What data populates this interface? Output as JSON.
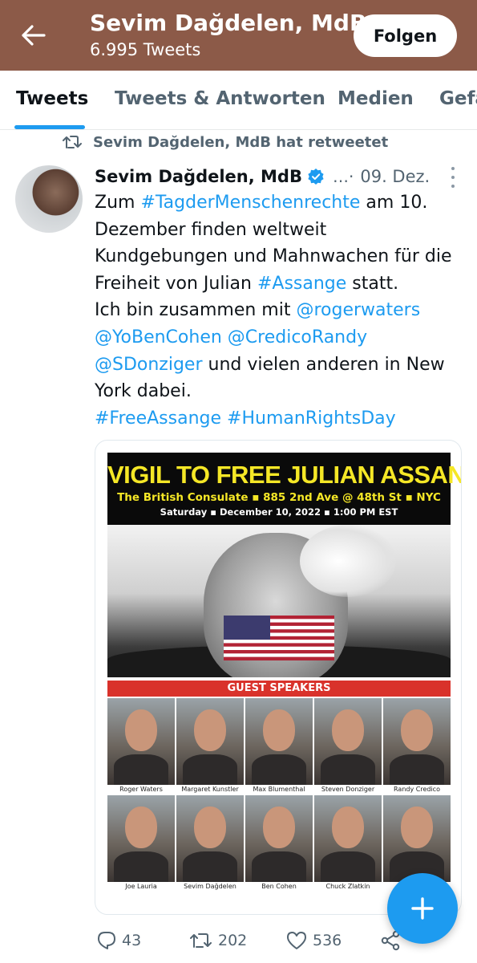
{
  "header": {
    "title": "Sevim Dağdelen, MdB",
    "subtitle": "6.995 Tweets",
    "follow_label": "Folgen",
    "back_icon": "arrow-left-icon",
    "bg_color": "#8c5a48"
  },
  "tabs": [
    {
      "label": "Tweets",
      "active": true
    },
    {
      "label": "Tweets & Antworten",
      "active": false
    },
    {
      "label": "Medien",
      "active": false
    },
    {
      "label": "Gefä",
      "active": false
    }
  ],
  "retweet_notice": "Sevim Dağdelen, MdB hat retweetet",
  "tweet": {
    "author": "Sevim Dağdelen, MdB",
    "verified": true,
    "ellipsis": "…·",
    "date": "09. Dez.",
    "lines": [
      [
        {
          "t": "Zum "
        },
        {
          "t": "#TagderMenschenrechte",
          "link": true
        },
        {
          "t": " am 10."
        }
      ],
      [
        {
          "t": "Dezember finden weltweit"
        }
      ],
      [
        {
          "t": "Kundgebungen und Mahnwachen für die"
        }
      ],
      [
        {
          "t": "Freiheit von Julian "
        },
        {
          "t": "#Assange",
          "link": true
        },
        {
          "t": " statt."
        }
      ],
      [
        {
          "t": "Ich bin zusammen mit "
        },
        {
          "t": "@rogerwaters",
          "link": true
        }
      ],
      [
        {
          "t": "@YoBenCohen",
          "link": true
        },
        {
          "t": " "
        },
        {
          "t": "@CredicoRandy",
          "link": true
        }
      ],
      [
        {
          "t": "@SDonziger",
          "link": true
        },
        {
          "t": " und vielen anderen in New"
        }
      ],
      [
        {
          "t": "York dabei."
        }
      ],
      [
        {
          "t": "#FreeAssange",
          "link": true
        },
        {
          "t": " "
        },
        {
          "t": "#HumanRightsDay",
          "link": true
        }
      ]
    ],
    "link_color": "#1d9bf0"
  },
  "poster": {
    "title": "VIGIL TO FREE JULIAN ASSANGE",
    "location": "The British Consulate ▪ 885 2nd Ave @ 48th St ▪ NYC",
    "datetime": "Saturday ▪ December 10, 2022 ▪ 1:00 PM EST",
    "guest_header": "GUEST SPEAKERS",
    "speakers": [
      "Roger Waters",
      "Margaret Kunstler",
      "Max Blumenthal",
      "Steven Donziger",
      "Randy Credico",
      "Joe Lauria",
      "Sevim Dağdelen",
      "Ben Cohen",
      "Chuck Zlatkin",
      ""
    ]
  },
  "actions": {
    "replies": "43",
    "retweets": "202",
    "likes": "536"
  },
  "fab_icon": "plus-icon"
}
